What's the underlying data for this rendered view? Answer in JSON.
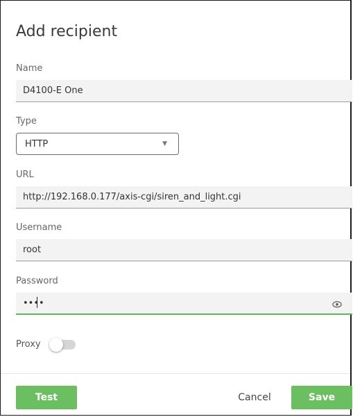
{
  "dialog": {
    "title": "Add recipient"
  },
  "fields": {
    "name": {
      "label": "Name",
      "value": "D4100-E One"
    },
    "type": {
      "label": "Type",
      "value": "HTTP"
    },
    "url": {
      "label": "URL",
      "value": "http://192.168.0.177/axis-cgi/siren_and_light.cgi"
    },
    "username": {
      "label": "Username",
      "value": "root"
    },
    "password": {
      "label": "Password",
      "value": "••••"
    }
  },
  "proxy": {
    "label": "Proxy",
    "enabled": false
  },
  "buttons": {
    "test": "Test",
    "cancel": "Cancel",
    "save": "Save"
  },
  "icons": {
    "dropdown": "caret-down-icon",
    "show_password": "eye-icon"
  },
  "colors": {
    "accent": "#6cbf61",
    "field_background": "#f3f3f3"
  }
}
